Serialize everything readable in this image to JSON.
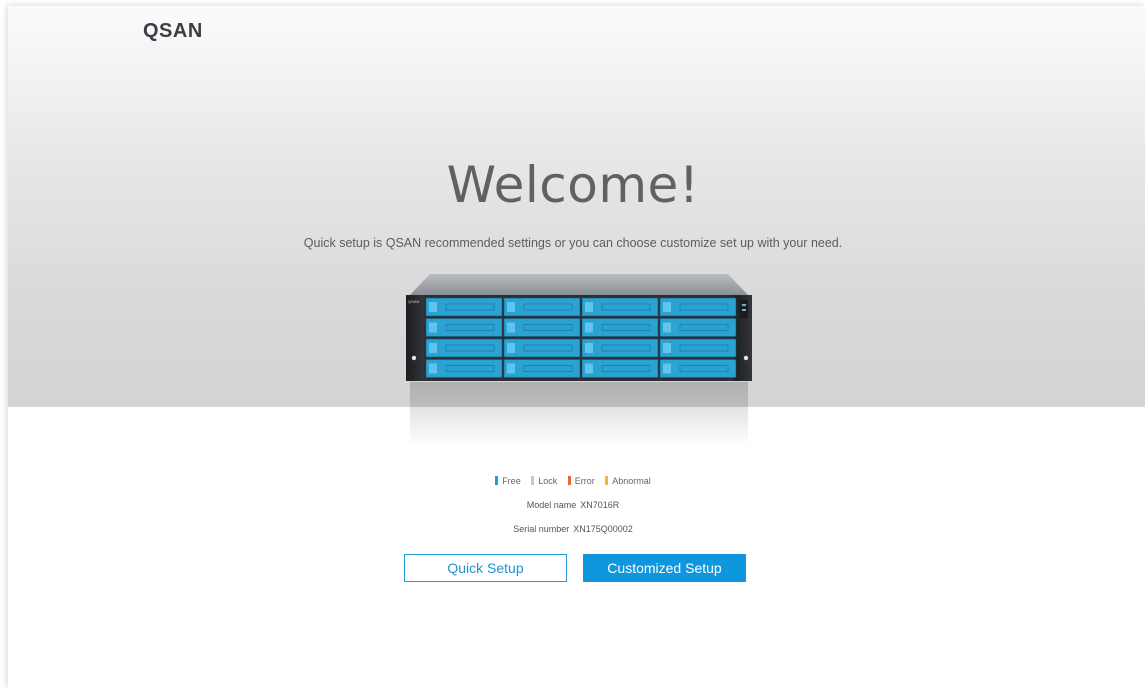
{
  "brand": {
    "logo_text": "QSAN"
  },
  "hero": {
    "title": "Welcome!",
    "subtitle": "Quick setup is QSAN recommended settings or you can choose customize set up with your need."
  },
  "device": {
    "image_label": "XN7016R enclosure front view",
    "drive_bays": 16,
    "drive_state": "Free"
  },
  "legend": [
    {
      "label": "Free",
      "color": "#1fa0cf"
    },
    {
      "label": "Lock",
      "color": "#c8c8c8"
    },
    {
      "label": "Error",
      "color": "#e8663a"
    },
    {
      "label": "Abnormal",
      "color": "#f2b632"
    }
  ],
  "model": {
    "label": "Model name",
    "value": "XN7016R"
  },
  "serial": {
    "label": "Serial number",
    "value": "XN175Q00002"
  },
  "buttons": {
    "quick": "Quick Setup",
    "custom": "Customized Setup"
  },
  "colors": {
    "accent": "#0e97de",
    "drive_free": "#2aa3d3"
  }
}
